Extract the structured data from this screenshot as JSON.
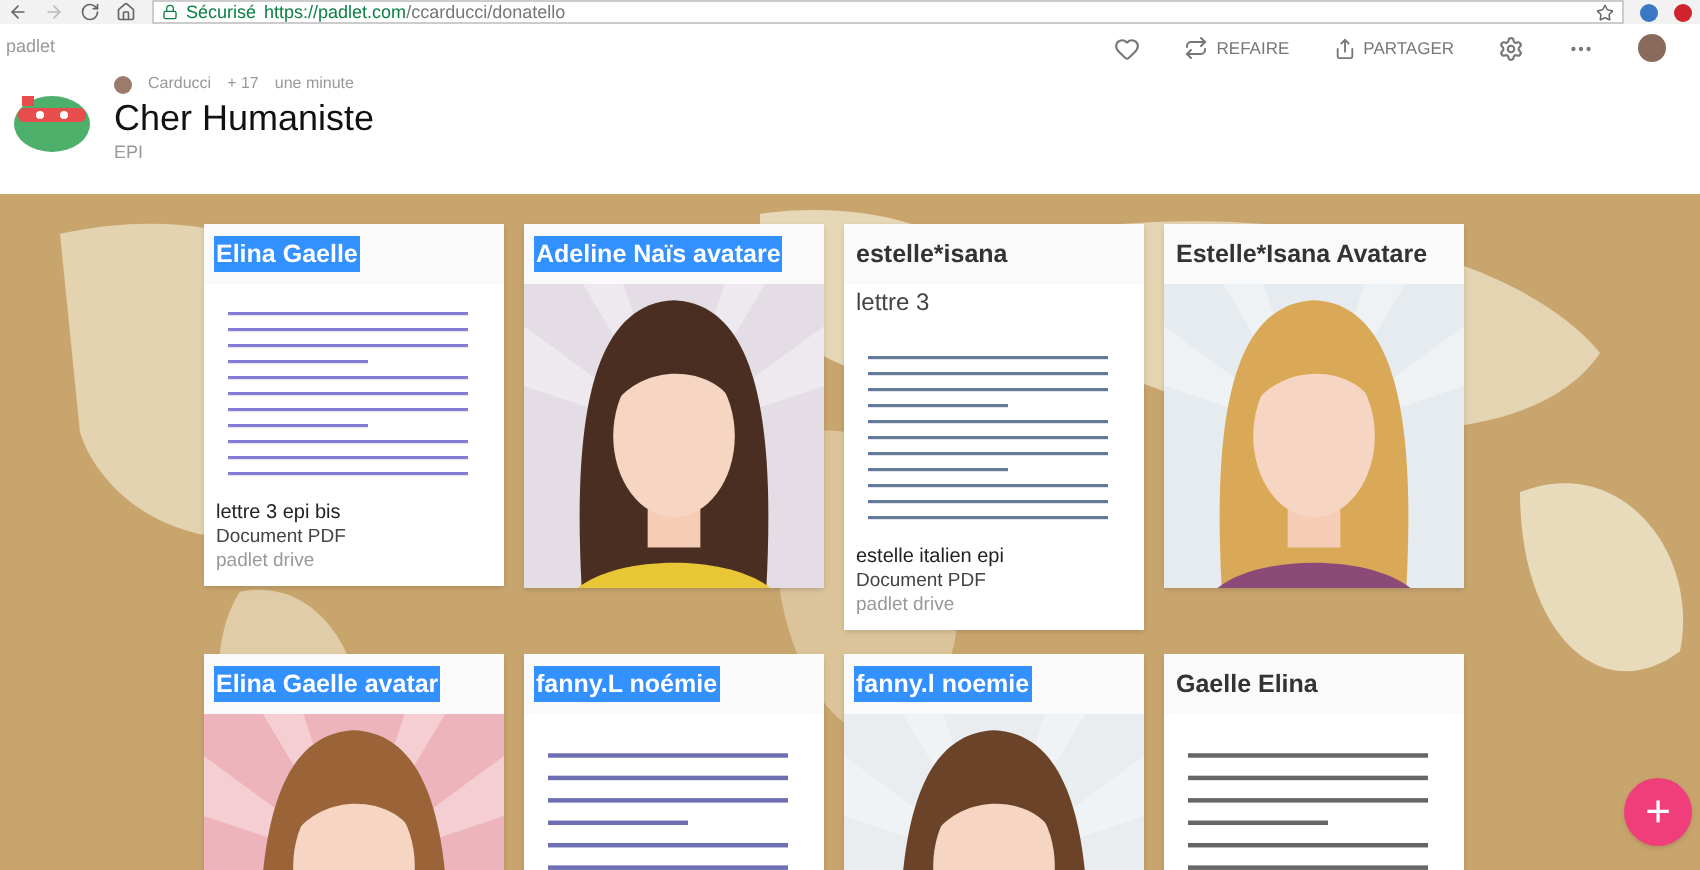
{
  "browser": {
    "secure_label": "Sécurisé",
    "url_host": "https://padlet.com",
    "url_path": "/ccarducci/donatello"
  },
  "app": {
    "logo": "padlet"
  },
  "header": {
    "author": "Carducci",
    "count": "+ 17",
    "time": "une minute",
    "title": "Cher Humaniste",
    "subtitle": "EPI"
  },
  "actions": [
    {
      "kind": "like"
    },
    {
      "kind": "remake",
      "label": "REFAIRE"
    },
    {
      "kind": "share",
      "label": "PARTAGER"
    },
    {
      "kind": "settings"
    },
    {
      "kind": "more"
    },
    {
      "kind": "avatar"
    }
  ],
  "cards": [
    {
      "title": "Elina Gaelle",
      "highlighted": true,
      "media": {
        "kind": "document"
      },
      "attachment": {
        "name": "lettre 3 epi bis",
        "type": "Document PDF",
        "source": "padlet drive"
      }
    },
    {
      "title": "Adeline Naïs avatare",
      "highlighted": true
    },
    {
      "title": "estelle*isana",
      "highlighted": false,
      "subtitle": "lettre 3",
      "media": {
        "kind": "document"
      },
      "attachment": {
        "name": "estelle italien epi",
        "type": "Document PDF",
        "source": "padlet drive"
      }
    },
    {
      "title": "Estelle*Isana Avatare",
      "highlighted": false
    },
    {
      "title": "Elina Gaelle avatar",
      "highlighted": true
    },
    {
      "title": "fanny.L noémie",
      "highlighted": true,
      "media": {
        "kind": "document"
      }
    },
    {
      "title": "fanny.l noemie",
      "highlighted": true
    },
    {
      "title": "Gaelle Elina",
      "highlighted": false,
      "media": {
        "kind": "document"
      }
    }
  ],
  "fab": {
    "label": "+"
  }
}
